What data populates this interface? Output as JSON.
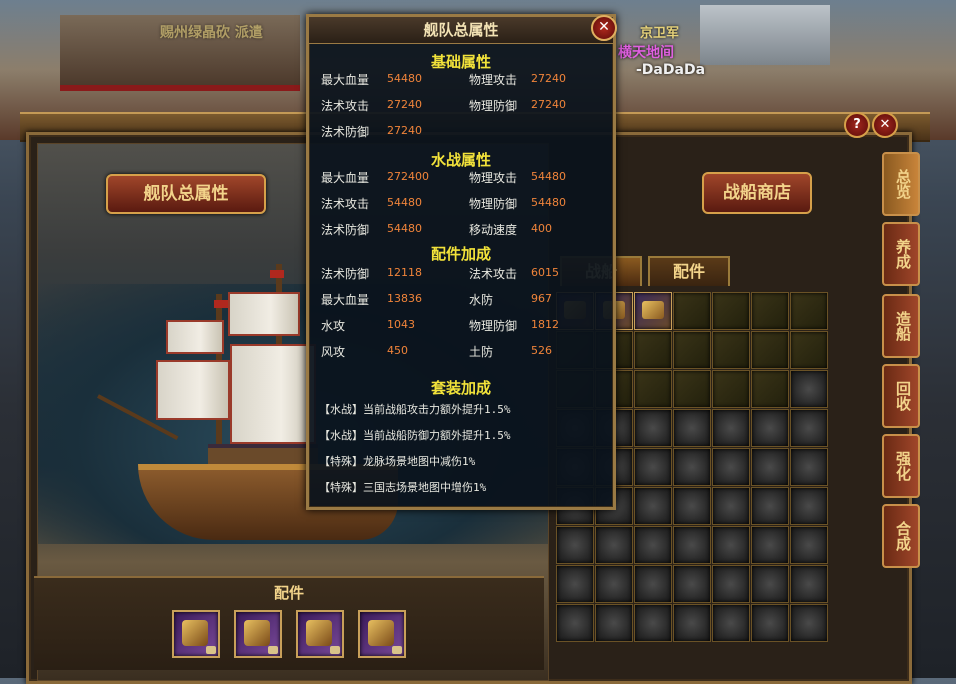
{
  "scene": {
    "text_left": "赐州绿晶砍 派遣",
    "text_right_1": "京卫军",
    "text_right_2": "横天地间",
    "text_right_3": "-DaDaDa"
  },
  "main": {
    "fleet_attr_button": "舰队总属性",
    "shop_button": "战船商店",
    "tabs": [
      {
        "label": "战船",
        "active": true
      },
      {
        "label": "配件",
        "active": false
      }
    ],
    "parts_title": "配件",
    "help_button": "?",
    "close_button": "✕"
  },
  "side_nav": [
    {
      "label": "总览",
      "active": true
    },
    {
      "label": "养成",
      "active": false
    },
    {
      "label": "造船",
      "active": false
    },
    {
      "label": "回收",
      "active": false
    },
    {
      "label": "强化",
      "active": false
    },
    {
      "label": "合成",
      "active": false
    }
  ],
  "grid": {
    "rows": [
      [
        "item",
        "item",
        "item",
        "empty",
        "empty",
        "empty",
        "empty"
      ],
      [
        "empty",
        "empty",
        "empty",
        "empty",
        "empty",
        "empty",
        "empty"
      ],
      [
        "empty",
        "empty",
        "empty",
        "empty",
        "empty",
        "empty",
        "locked"
      ],
      [
        "locked",
        "locked",
        "locked",
        "locked",
        "locked",
        "locked",
        "locked"
      ],
      [
        "locked",
        "locked",
        "locked",
        "locked",
        "locked",
        "locked",
        "locked"
      ],
      [
        "locked",
        "locked",
        "locked",
        "locked",
        "locked",
        "locked",
        "locked"
      ],
      [
        "locked",
        "locked",
        "locked",
        "locked",
        "locked",
        "locked",
        "locked"
      ],
      [
        "locked",
        "locked",
        "locked",
        "locked",
        "locked",
        "locked",
        "locked"
      ],
      [
        "locked",
        "locked",
        "locked",
        "locked",
        "locked",
        "locked",
        "locked"
      ]
    ]
  },
  "popup": {
    "title": "舰队总属性",
    "close": "✕",
    "basic": {
      "title": "基础属性",
      "stats": [
        {
          "label": "最大血量",
          "value": "54480"
        },
        {
          "label": "物理攻击",
          "value": "27240"
        },
        {
          "label": "法术攻击",
          "value": "27240"
        },
        {
          "label": "物理防御",
          "value": "27240"
        },
        {
          "label": "法术防御",
          "value": "27240"
        }
      ]
    },
    "naval": {
      "title": "水战属性",
      "stats": [
        {
          "label": "最大血量",
          "value": "272400"
        },
        {
          "label": "物理攻击",
          "value": "54480"
        },
        {
          "label": "法术攻击",
          "value": "54480"
        },
        {
          "label": "物理防御",
          "value": "54480"
        },
        {
          "label": "法术防御",
          "value": "54480"
        },
        {
          "label": "移动速度",
          "value": "400"
        }
      ]
    },
    "parts": {
      "title": "配件加成",
      "stats": [
        {
          "label": "法术防御",
          "value": "12118"
        },
        {
          "label": "法术攻击",
          "value": "6015"
        },
        {
          "label": "最大血量",
          "value": "13836"
        },
        {
          "label": "水防",
          "value": "967"
        },
        {
          "label": "水攻",
          "value": "1043"
        },
        {
          "label": "物理防御",
          "value": "1812"
        },
        {
          "label": "风攻",
          "value": "450"
        },
        {
          "label": "土防",
          "value": "526"
        }
      ]
    },
    "set": {
      "title": "套装加成",
      "lines": [
        "【水战】当前战船攻击力额外提升1.5%",
        "【水战】当前战船防御力额外提升1.5%",
        "【特殊】龙脉场景地图中减伤1%",
        "【特殊】三国志场景地图中增伤1%"
      ]
    }
  }
}
